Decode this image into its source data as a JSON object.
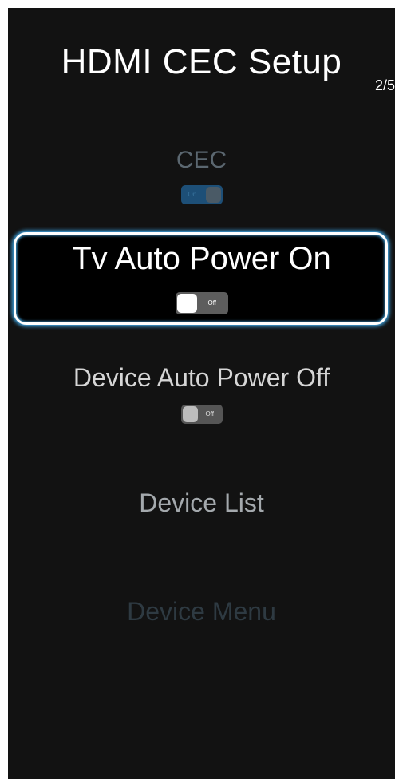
{
  "header": {
    "title": "HDMI CEC Setup",
    "page_indicator": "2/5"
  },
  "menu": {
    "cec": {
      "label": "CEC",
      "toggle_state": "On",
      "enabled": false
    },
    "tv_auto_power_on": {
      "label": "Tv Auto Power On",
      "toggle_state": "Off",
      "focused": true
    },
    "device_auto_power_off": {
      "label": "Device Auto Power Off",
      "toggle_state": "Off"
    },
    "device_list": {
      "label": "Device List"
    },
    "device_menu": {
      "label": "Device Menu",
      "enabled": false
    }
  },
  "colors": {
    "background": "#121212",
    "focus_ring": "#3fa9e8",
    "toggle_on": "#1d4f77"
  }
}
